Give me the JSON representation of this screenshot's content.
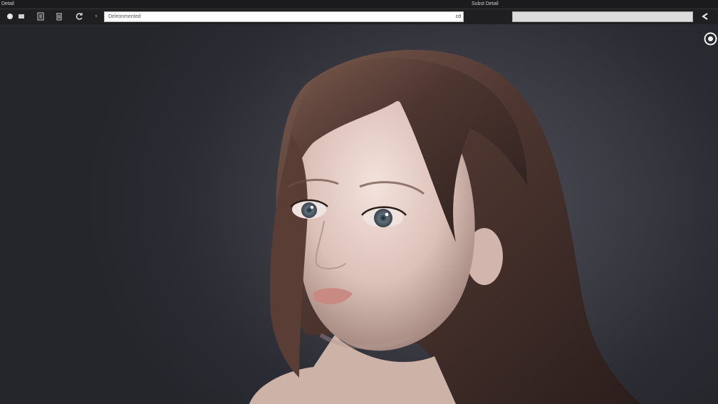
{
  "titlebar": {
    "app_title": "Detail",
    "window_title": "Subst Detail"
  },
  "toolbar": {
    "url_value": "Deleonmented",
    "url_action_label": "cd"
  },
  "icons": {
    "record": "record-icon",
    "panel": "panel-icon",
    "list": "list-icon",
    "trash": "trash-icon",
    "refresh": "refresh-icon",
    "back": "back-arrow-icon",
    "target": "target-icon"
  },
  "colors": {
    "chrome_bg": "#1f1f22",
    "url_bg": "#ffffff",
    "search_bg": "#dcdcdc",
    "canvas_bg": "#2a2b31"
  }
}
